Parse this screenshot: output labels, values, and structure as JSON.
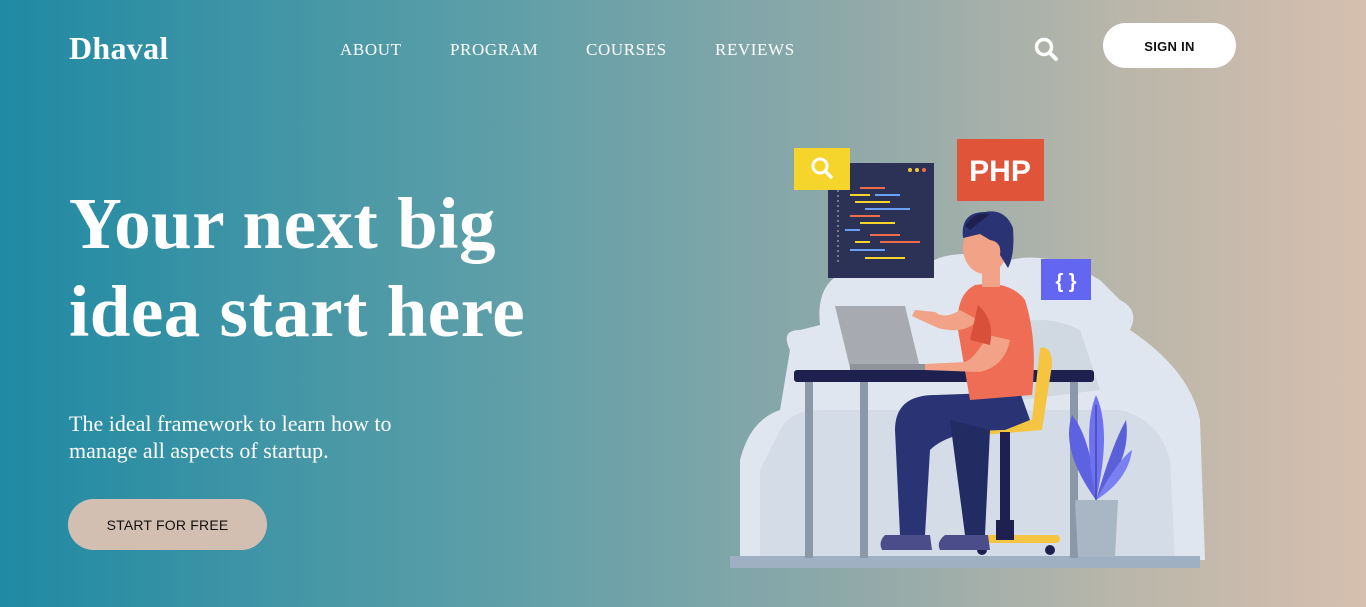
{
  "brand": {
    "name": "Dhaval"
  },
  "nav": {
    "items": [
      {
        "label": "ABOUT"
      },
      {
        "label": "PROGRAM"
      },
      {
        "label": "COURSES"
      },
      {
        "label": "REVIEWS"
      }
    ]
  },
  "header": {
    "search_icon": "search-icon",
    "signin_label": "SIGN IN"
  },
  "hero": {
    "headline_line1": "Your next big",
    "headline_line2": "idea start here",
    "subtext_line1": "The ideal framework to learn how to",
    "subtext_line2": "manage all aspects of startup.",
    "cta_label": "START FOR FREE"
  },
  "illustration": {
    "php_badge": "PHP",
    "braces_badge": "{ }",
    "search_badge_icon": "search-icon"
  },
  "colors": {
    "gradient_start": "#1f8aa3",
    "gradient_end": "#d6bfae",
    "cta_background": "#d3bfb1",
    "signin_background": "#ffffff",
    "php_badge": "#e0553a",
    "braces_badge": "#6366f1",
    "search_badge": "#f5d42c",
    "code_window": "#2c3256"
  }
}
